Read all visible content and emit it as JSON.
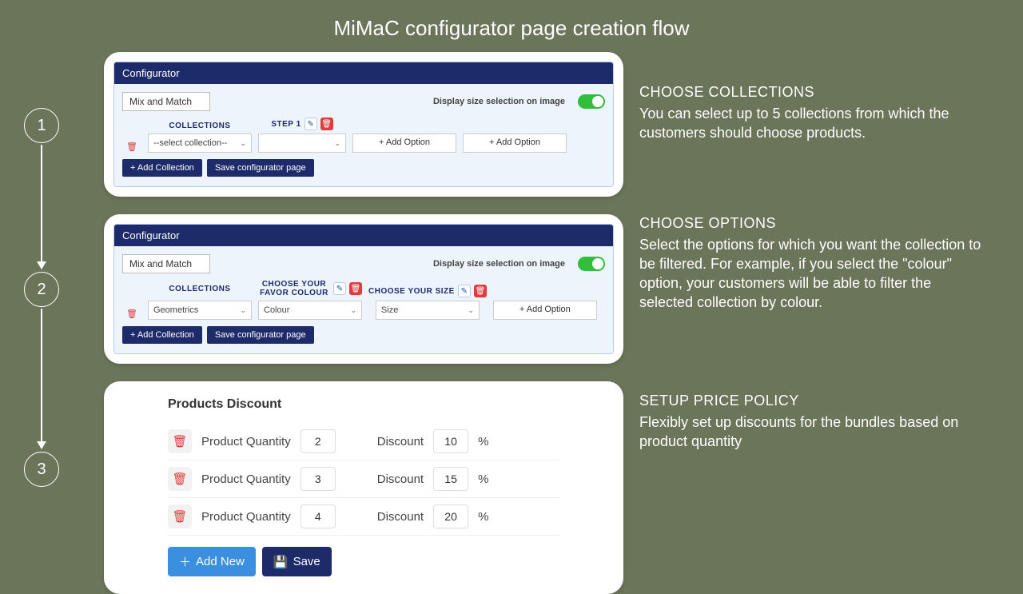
{
  "page_title": "MiMaC configurator page creation flow",
  "steps": {
    "n1": "1",
    "n2": "2",
    "n3": "3"
  },
  "desc": {
    "s1": {
      "head": "CHOOSE COLLECTIONS",
      "body": "You can select up to 5 collections from which the customers should choose products."
    },
    "s2": {
      "head": "CHOOSE OPTIONS",
      "body": "Select the options for which you want the collection to be filtered. For example, if you select the \"colour\" option, your customers will be able to filter the selected collection by colour."
    },
    "s3": {
      "head": "SETUP PRICE POLICY",
      "body": "Flexibly set up discounts for the bundles based on product quantity"
    }
  },
  "config": {
    "header": "Configurator",
    "name": "Mix and Match",
    "toggle_label": "Display size selection on image",
    "collections_label": "COLLECTIONS",
    "step1_label": "STEP 1",
    "select_collection_placeholder": "--select collection--",
    "add_option": "+  Add Option",
    "add_collection": "+ Add Collection",
    "save_page": "Save configurator page",
    "step2_col1": "CHOOSE YOUR FAVOR COLOUR",
    "step2_col2": "CHOOSE YOUR SIZE",
    "geometrics": "Geometrics",
    "colour": "Colour",
    "size": "Size"
  },
  "discount": {
    "title": "Products Discount",
    "qty_label": "Product Quantity",
    "disc_label": "Discount",
    "pct": "%",
    "rows": [
      {
        "qty": "2",
        "disc": "10"
      },
      {
        "qty": "3",
        "disc": "15"
      },
      {
        "qty": "4",
        "disc": "20"
      }
    ],
    "add_new": "Add New",
    "save": "Save"
  }
}
